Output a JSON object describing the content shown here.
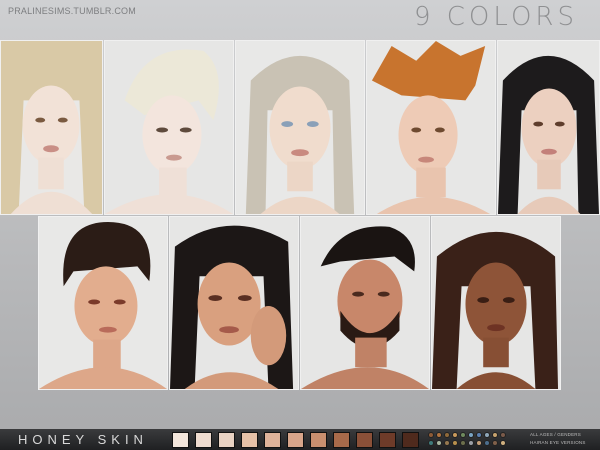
{
  "header": {
    "credit": "PRALINESIMS.TUMBLR.COM",
    "headline": "9 COLORS"
  },
  "footer": {
    "product_name": "HONEY SKIN",
    "info_line_1": "ALL AGES / GENDERS",
    "info_line_2": "HAIRAN EYE VERSIONS"
  },
  "palette": {
    "skin_swatches": [
      "#f3e6dc",
      "#efdcd0",
      "#e8d2c3",
      "#e7c2a8",
      "#dfb39a",
      "#d8a58a",
      "#c98f6f",
      "#a86a4a",
      "#8a5038",
      "#6e3b29",
      "#4f2a1d"
    ],
    "eye_colors": [
      "#8e5b36",
      "#b0733f",
      "#8f6a3a",
      "#c99a5c",
      "#6f8a5e",
      "#7aa4c4",
      "#5b7fb0",
      "#8fa7b9",
      "#c7a36e",
      "#7a5a4a",
      "#3f7a7a",
      "#a8b6a0",
      "#96784f",
      "#b8904d",
      "#6c6f4c",
      "#9ca0a6",
      "#c6a07a",
      "#4c6e8e",
      "#80604a",
      "#d0b080"
    ]
  }
}
